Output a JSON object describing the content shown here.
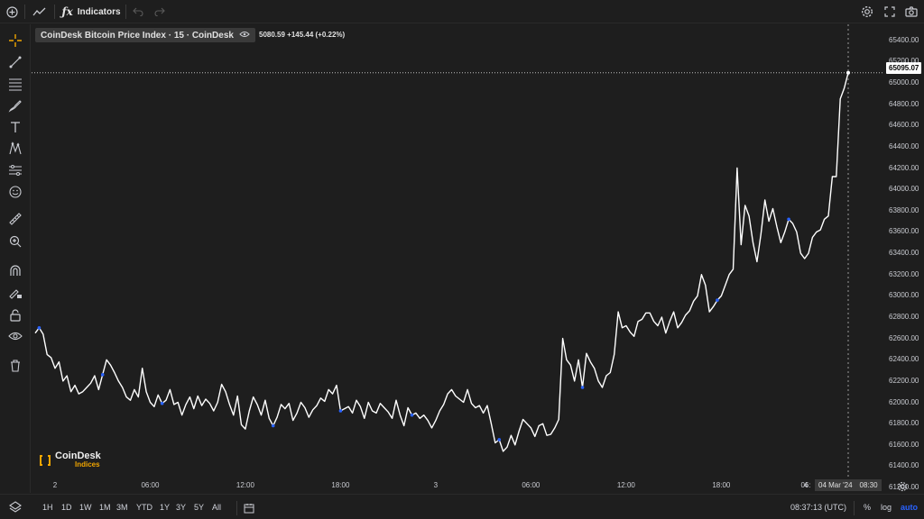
{
  "toolbar": {
    "indicators_label": "Indicators",
    "icons": [
      "add-symbol-icon",
      "chart-type-icon",
      "function-icon",
      "undo-icon",
      "redo-icon",
      "settings-icon",
      "fullscreen-icon",
      "camera-icon"
    ]
  },
  "left_tools": [
    "crosshair-icon",
    "trend-line-icon",
    "fib-icon",
    "brush-icon",
    "text-icon",
    "pattern-icon",
    "prediction-icon",
    "emoji-icon",
    "ruler-icon",
    "zoom-in-icon",
    "magnet-icon",
    "lock-draw-icon",
    "lock-icon",
    "eye-icon",
    "trash-icon"
  ],
  "legend": {
    "title": "CoinDesk Bitcoin Price Index · 15 · CoinDesk",
    "values": "5080.59 +145.44 (+0.22%)"
  },
  "logo": {
    "brand": "CoinDesk",
    "sub": "Indices",
    "color": "#f0a500"
  },
  "price_axis": {
    "ticks": [
      "65400.00",
      "65200.00",
      "65000.00",
      "64800.00",
      "64600.00",
      "64400.00",
      "64200.00",
      "64000.00",
      "63800.00",
      "63600.00",
      "63400.00",
      "63200.00",
      "63000.00",
      "62800.00",
      "62600.00",
      "62400.00",
      "62200.00",
      "62000.00",
      "61800.00",
      "61600.00",
      "61400.00",
      "61200.00"
    ],
    "last_price": "65095.07"
  },
  "time_axis": {
    "ticks": [
      "2",
      "06:00",
      "12:00",
      "18:00",
      "3",
      "06:00",
      "12:00",
      "18:00",
      "4",
      "06:"
    ],
    "crosshair_date": "04 Mar '24",
    "crosshair_time": "08:30"
  },
  "bottombar": {
    "ranges": [
      "1H",
      "1D",
      "1W",
      "1M",
      "3M",
      "YTD",
      "1Y",
      "3Y",
      "5Y",
      "All"
    ],
    "clock": "08:37:13 (UTC)",
    "percent": "%",
    "log": "log",
    "auto": "auto"
  },
  "colors": {
    "background": "#1e1e1e",
    "line": "#ffffff",
    "marker": "#2962ff",
    "accent": "#f0a500"
  },
  "chart_data": {
    "type": "line",
    "x_start": "2024-03-02 00:00",
    "interval": "15",
    "ylim": [
      61150,
      65550
    ],
    "last": 65095.07,
    "values": [
      62650,
      62700,
      62640,
      62450,
      62420,
      62320,
      62380,
      62200,
      62250,
      62100,
      62160,
      62080,
      62100,
      62140,
      62180,
      62250,
      62120,
      62260,
      62400,
      62350,
      62280,
      62200,
      62140,
      62050,
      62020,
      62120,
      62050,
      62320,
      62100,
      62000,
      61960,
      62070,
      61990,
      62020,
      62120,
      61980,
      62000,
      61880,
      61980,
      62050,
      61940,
      62060,
      61970,
      62030,
      61990,
      61920,
      62000,
      62170,
      62100,
      61980,
      61880,
      62060,
      61790,
      61750,
      61920,
      62050,
      61980,
      61880,
      62020,
      61850,
      61780,
      61860,
      61980,
      61940,
      61990,
      61830,
      61900,
      62000,
      61950,
      61860,
      61930,
      61970,
      62040,
      62010,
      62120,
      62080,
      62160,
      61920,
      61940,
      61960,
      61900,
      62020,
      61960,
      61850,
      62000,
      61920,
      61900,
      61990,
      61950,
      61910,
      61850,
      62020,
      61880,
      61780,
      61950,
      61880,
      61900,
      61850,
      61880,
      61830,
      61760,
      61830,
      61920,
      61980,
      62080,
      62120,
      62060,
      62030,
      62000,
      62120,
      61990,
      61950,
      61970,
      61900,
      61970,
      61800,
      61620,
      61650,
      61540,
      61580,
      61690,
      61600,
      61730,
      61840,
      61800,
      61760,
      61680,
      61780,
      61800,
      61690,
      61700,
      61760,
      61840,
      62600,
      62400,
      62350,
      62200,
      62400,
      62140,
      62460,
      62380,
      62320,
      62200,
      62140,
      62250,
      62280,
      62450,
      62850,
      62700,
      62720,
      62660,
      62620,
      62760,
      62780,
      62840,
      62840,
      62760,
      62720,
      62800,
      62650,
      62760,
      62850,
      62700,
      62750,
      62820,
      62860,
      62950,
      63000,
      63200,
      63100,
      62850,
      62900,
      62960,
      63000,
      63100,
      63200,
      63250,
      64200,
      63480,
      63850,
      63750,
      63500,
      63320,
      63580,
      63900,
      63700,
      63820,
      63650,
      63500,
      63600,
      63720,
      63680,
      63600,
      63400,
      63350,
      63400,
      63550,
      63600,
      63620,
      63720,
      63750,
      64120,
      64120,
      64850,
      64950,
      65095
    ]
  }
}
